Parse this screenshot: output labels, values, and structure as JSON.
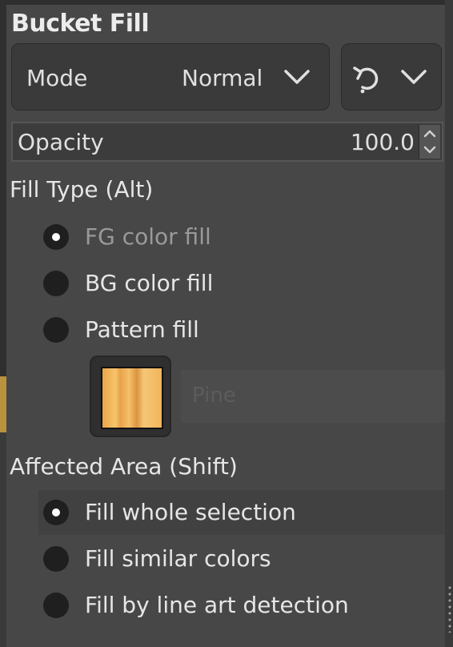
{
  "panel": {
    "title": "Bucket Fill"
  },
  "mode": {
    "label": "Mode",
    "value": "Normal"
  },
  "opacity": {
    "label": "Opacity",
    "value": "100.0"
  },
  "fill_type": {
    "label": "Fill Type  (Alt)",
    "options": [
      {
        "label": "FG color fill",
        "checked": true
      },
      {
        "label": "BG color fill",
        "checked": false
      },
      {
        "label": "Pattern fill",
        "checked": false
      }
    ],
    "pattern_name": "Pine"
  },
  "affected_area": {
    "label": "Affected Area  (Shift)",
    "options": [
      {
        "label": "Fill whole selection",
        "checked": true
      },
      {
        "label": "Fill similar colors",
        "checked": false
      },
      {
        "label": "Fill by line art detection",
        "checked": false
      }
    ]
  },
  "icons": {
    "mode_dropdown": "chevron-down-icon",
    "reset": "reset-icon",
    "spinner": "spinner-arrows-icon"
  }
}
